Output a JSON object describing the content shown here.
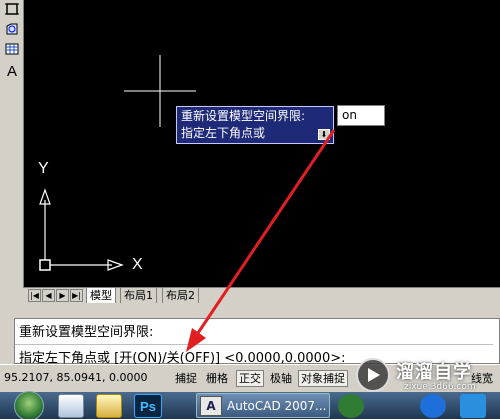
{
  "toolbar": {
    "icons": [
      "block-icon",
      "shape-icon",
      "table-icon",
      "text-icon"
    ],
    "text_label": "A"
  },
  "dynamic_input": {
    "line1": "重新设置模型空间界限:",
    "line2": "指定左下角点或",
    "value": "on",
    "arrow": "⬇"
  },
  "ucs": {
    "y_label": "Y",
    "x_label": "X"
  },
  "layout_tabs": {
    "nav": [
      "|◀",
      "◀",
      "▶",
      "▶|"
    ],
    "tabs": [
      "模型",
      "布局1",
      "布局2"
    ],
    "active": 0
  },
  "command": {
    "line1": "重新设置模型空间界限:",
    "line2": "指定左下角点或 [开(ON)/关(OFF)] <0.0000,0.0000>:"
  },
  "status": {
    "coords": "95.2107,   85.0941, 0.0000",
    "buttons": [
      "捕捉",
      "栅格",
      "正交",
      "极轴",
      "对象捕捉",
      "线宽"
    ]
  },
  "taskbar": {
    "app_label": "AutoCAD 2007...",
    "app_icon": "A"
  },
  "watermark": {
    "text": "溜溜自学",
    "sub": "zixue.3d66.com"
  },
  "colors": {
    "canvas": "#000000",
    "tooltip_bg": "#1e2a78",
    "annotation_arrow": "#e02020"
  }
}
